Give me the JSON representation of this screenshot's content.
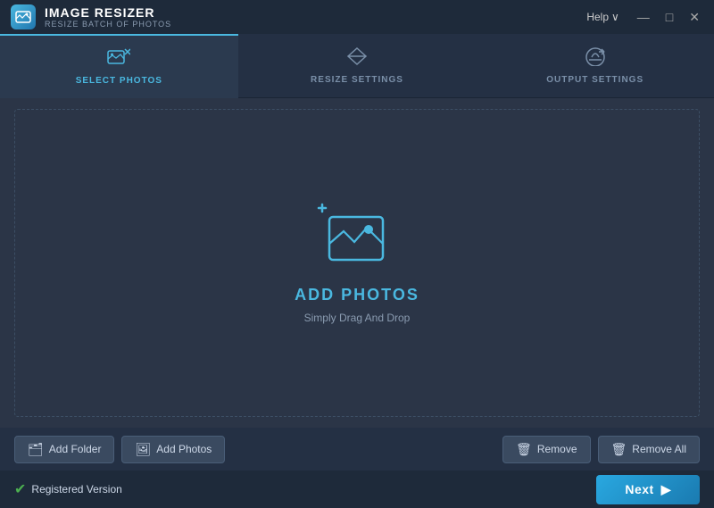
{
  "titleBar": {
    "appTitle": "IMAGE RESIZER",
    "appSubtitle": "RESIZE BATCH OF PHOTOS",
    "helpLabel": "Help",
    "helpChevron": "∨",
    "minimizeIcon": "—",
    "maximizeIcon": "□",
    "closeIcon": "✕"
  },
  "tabs": [
    {
      "id": "select-photos",
      "label": "SELECT PHOTOS",
      "active": true
    },
    {
      "id": "resize-settings",
      "label": "RESIZE SETTINGS",
      "active": false
    },
    {
      "id": "output-settings",
      "label": "OUTPUT SETTINGS",
      "active": false
    }
  ],
  "dropArea": {
    "addPhotosLabel": "ADD PHOTOS",
    "addPhotosSubtitle": "Simply Drag And Drop"
  },
  "toolbar": {
    "addFolderLabel": "Add Folder",
    "addPhotosLabel": "Add Photos",
    "removeLabel": "Remove",
    "removeAllLabel": "Remove All"
  },
  "footer": {
    "registeredLabel": "Registered Version",
    "nextLabel": "Next"
  }
}
